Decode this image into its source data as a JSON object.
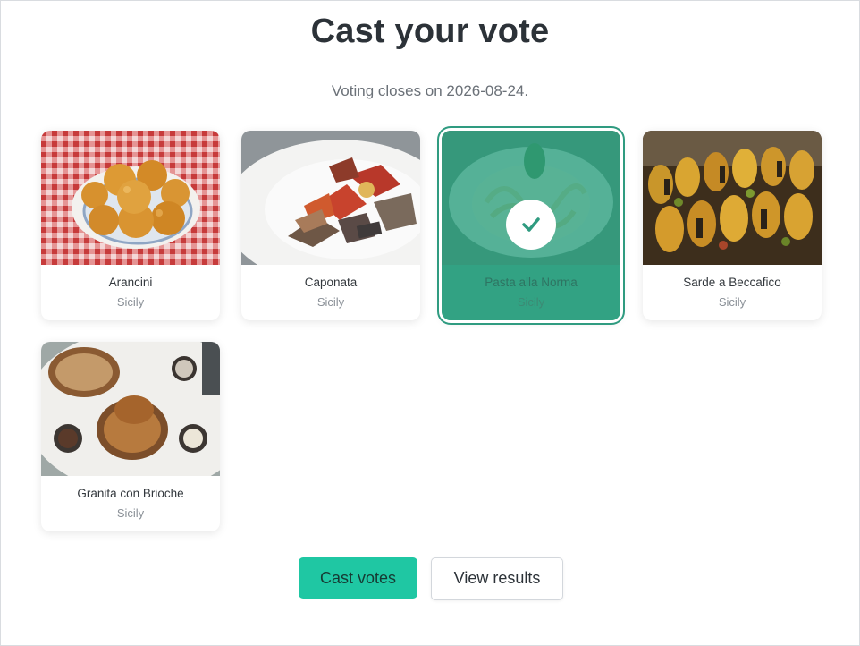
{
  "page": {
    "title": "Cast your vote",
    "subtitle": "Voting closes on 2026-08-24."
  },
  "dishes": [
    {
      "name": "Arancini",
      "region": "Sicily",
      "selected": false,
      "image": "arancini-photo"
    },
    {
      "name": "Caponata",
      "region": "Sicily",
      "selected": false,
      "image": "caponata-photo"
    },
    {
      "name": "Pasta alla Norma",
      "region": "Sicily",
      "selected": true,
      "image": "pasta-photo"
    },
    {
      "name": "Sarde a Beccafico",
      "region": "Sicily",
      "selected": false,
      "image": "sardines-photo"
    },
    {
      "name": "Granita con Brioche",
      "region": "Sicily",
      "selected": false,
      "image": "granita-photo"
    }
  ],
  "actions": {
    "cast_label": "Cast votes",
    "results_label": "View results"
  },
  "colors": {
    "accent": "#1fc7a3",
    "selected_overlay": "#2ca080"
  },
  "icons": {
    "selected_mark": "check-icon"
  }
}
